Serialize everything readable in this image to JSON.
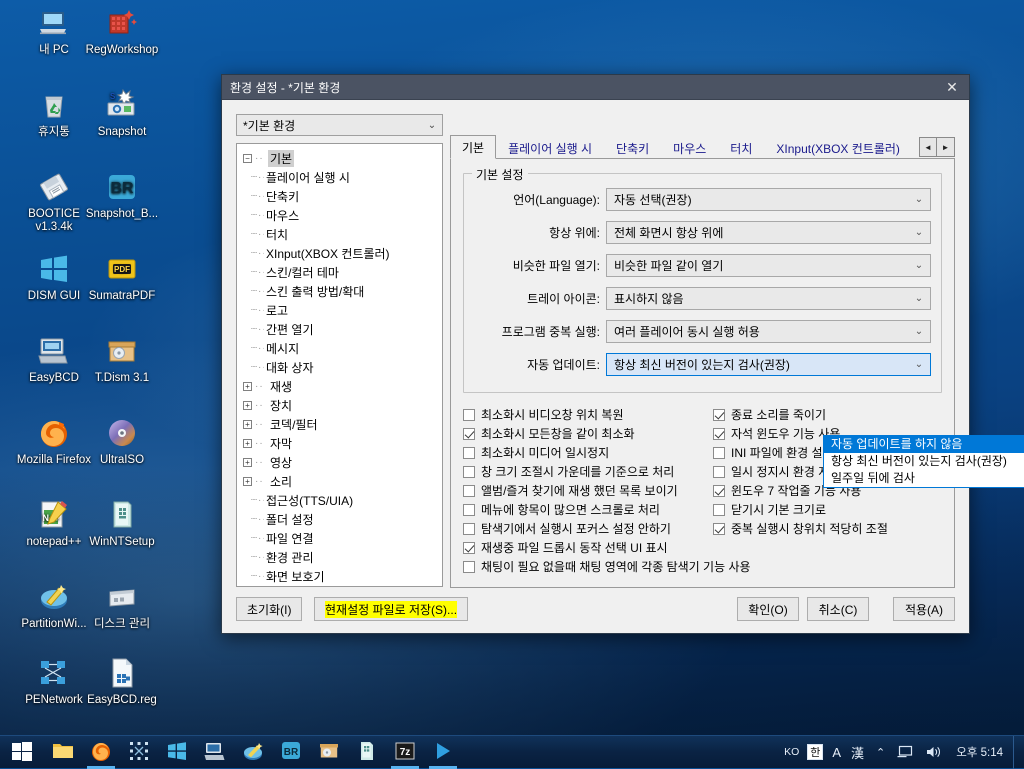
{
  "desktop": {
    "icons": [
      {
        "label": "내 PC",
        "icon": "computer-icon"
      },
      {
        "label": "RegWorkshop",
        "icon": "regworkshop-icon"
      },
      {
        "label": "휴지통",
        "icon": "recycle-bin-icon"
      },
      {
        "label": "Snapshot",
        "icon": "snapshot-icon"
      },
      {
        "label": "BOOTICE v1.3.4k",
        "icon": "bootice-icon"
      },
      {
        "label": "Snapshot_B...",
        "icon": "bootrepair-icon"
      },
      {
        "label": "DISM GUI",
        "icon": "dism-gui-icon"
      },
      {
        "label": "SumatraPDF",
        "icon": "sumatrapdf-icon"
      },
      {
        "label": "EasyBCD",
        "icon": "easybcd-icon"
      },
      {
        "label": "T.Dism 3.1",
        "icon": "tdism-icon"
      },
      {
        "label": "Mozilla Firefox",
        "icon": "firefox-icon"
      },
      {
        "label": "UltraISO",
        "icon": "ultraiso-icon"
      },
      {
        "label": "notepad++",
        "icon": "notepadpp-icon"
      },
      {
        "label": "WinNTSetup",
        "icon": "winntsetup-icon"
      },
      {
        "label": "PartitionWi...",
        "icon": "partitionwizard-icon"
      },
      {
        "label": "디스크 관리",
        "icon": "disk-management-icon"
      },
      {
        "label": "PENetwork",
        "icon": "penetwork-icon"
      },
      {
        "label": "EasyBCD.reg",
        "icon": "reg-file-icon"
      }
    ]
  },
  "window": {
    "title": "환경 설정 - *기본 환경",
    "close_label": "✕",
    "profile_combo": {
      "value": "*기본 환경",
      "arrow": "⌄"
    },
    "tree": [
      {
        "label": "기본",
        "level": 0,
        "expander": "−",
        "selected": true
      },
      {
        "label": "플레이어 실행 시",
        "level": 1,
        "expander": "",
        "selected": false
      },
      {
        "label": "단축키",
        "level": 1,
        "expander": "",
        "selected": false
      },
      {
        "label": "마우스",
        "level": 1,
        "expander": "",
        "selected": false
      },
      {
        "label": "터치",
        "level": 1,
        "expander": "",
        "selected": false
      },
      {
        "label": "XInput(XBOX 컨트롤러)",
        "level": 1,
        "expander": "",
        "selected": false
      },
      {
        "label": "스킨/컬러 테마",
        "level": 1,
        "expander": "",
        "selected": false
      },
      {
        "label": "스킨 출력 방법/확대",
        "level": 1,
        "expander": "",
        "selected": false
      },
      {
        "label": "로고",
        "level": 1,
        "expander": "",
        "selected": false
      },
      {
        "label": "간편 열기",
        "level": 1,
        "expander": "",
        "selected": false
      },
      {
        "label": "메시지",
        "level": 1,
        "expander": "",
        "selected": false
      },
      {
        "label": "대화 상자",
        "level": 1,
        "expander": "",
        "selected": false
      },
      {
        "label": "재생",
        "level": 0,
        "expander": "+",
        "selected": false
      },
      {
        "label": "장치",
        "level": 0,
        "expander": "+",
        "selected": false
      },
      {
        "label": "코덱/필터",
        "level": 0,
        "expander": "+",
        "selected": false
      },
      {
        "label": "자막",
        "level": 0,
        "expander": "+",
        "selected": false
      },
      {
        "label": "영상",
        "level": 0,
        "expander": "+",
        "selected": false
      },
      {
        "label": "소리",
        "level": 0,
        "expander": "+",
        "selected": false
      },
      {
        "label": "접근성(TTS/UIA)",
        "level": 1,
        "expander": "",
        "selected": false
      },
      {
        "label": "폴더 설정",
        "level": 1,
        "expander": "",
        "selected": false
      },
      {
        "label": "파일 연결",
        "level": 1,
        "expander": "",
        "selected": false
      },
      {
        "label": "환경 관리",
        "level": 1,
        "expander": "",
        "selected": false
      },
      {
        "label": "화면 보호기",
        "level": 1,
        "expander": "",
        "selected": false
      }
    ],
    "tabs": [
      {
        "label": "기본",
        "active": true
      },
      {
        "label": "플레이어 실행 시",
        "active": false
      },
      {
        "label": "단축키",
        "active": false
      },
      {
        "label": "마우스",
        "active": false
      },
      {
        "label": "터치",
        "active": false
      },
      {
        "label": "XInput(XBOX 컨트롤러)",
        "active": false
      }
    ],
    "tab_nav": {
      "prev": "◄",
      "next": "►"
    },
    "group": {
      "legend": "기본 설정",
      "fields": [
        {
          "label": "언어(Language):",
          "value": "자동 선택(권장)",
          "arrow": "⌄",
          "open": false
        },
        {
          "label": "항상 위에:",
          "value": "전체 화면시 항상 위에",
          "arrow": "⌄",
          "open": false
        },
        {
          "label": "비슷한 파일 열기:",
          "value": "비슷한 파일 같이 열기",
          "arrow": "⌄",
          "open": false
        },
        {
          "label": "트레이 아이콘:",
          "value": "표시하지 않음",
          "arrow": "⌄",
          "open": false
        },
        {
          "label": "프로그램 중복 실행:",
          "value": "여러 플레이어 동시 실행 허용",
          "arrow": "⌄",
          "open": false
        },
        {
          "label": "자동 업데이트:",
          "value": "항상 최신 버전이 있는지 검사(권장)",
          "arrow": "⌄",
          "open": true
        }
      ]
    },
    "dropdown": {
      "open": true,
      "options": [
        {
          "label": "자동 업데이트를 하지 않음",
          "selected": true
        },
        {
          "label": "항상 최신 버전이 있는지 검사(권장)",
          "selected": false
        },
        {
          "label": "일주일 뒤에 검사",
          "selected": false
        }
      ]
    },
    "checkboxes_left": [
      {
        "label": "최소화시 비디오창 위치 복원",
        "checked": false
      },
      {
        "label": "최소화시 모든창을 같이 최소화",
        "checked": true
      },
      {
        "label": "최소화시 미디어 일시정지",
        "checked": false
      },
      {
        "label": "창 크기 조절시 가운데를 기준으로 처리",
        "checked": false
      },
      {
        "label": "앨범/즐겨 찾기에 재생 했던 목록 보이기",
        "checked": false
      },
      {
        "label": "메뉴에 항목이 많으면 스크롤로 처리",
        "checked": false
      },
      {
        "label": "탐색기에서 실행시 포커스 설정 안하기",
        "checked": false
      },
      {
        "label": "재생중 파일 드롭시 동작 선택 UI 표시",
        "checked": true
      }
    ],
    "checkboxes_right": [
      {
        "label": "종료 소리를 죽이기",
        "checked": true
      },
      {
        "label": "자석 윈도우 기능 사용",
        "checked": true
      },
      {
        "label": "INI 파일에 환경 설정 저장",
        "checked": false
      },
      {
        "label": "일시 정지시 환경 저장",
        "checked": false
      },
      {
        "label": "윈도우 7 작업줄 기능 사용",
        "checked": true
      },
      {
        "label": "닫기시 기본 크기로",
        "checked": false
      },
      {
        "label": "중복 실행시 창위치 적당히 조절",
        "checked": true
      }
    ],
    "checkbox_wide": {
      "label": "채팅이 필요 없을때 채팅 영역에 각종 탐색기 기능 사용",
      "checked": false
    },
    "buttons": {
      "reset": "초기화(I)",
      "save_prefix": "현재",
      "save_rest": " 설정 파일로 저장(S)...",
      "ok": "확인(O)",
      "cancel": "취소(C)",
      "apply": "적용(A)"
    }
  },
  "taskbar": {
    "start_label": "start-button",
    "items": [
      {
        "name": "file-explorer-icon",
        "running": false
      },
      {
        "name": "firefox-icon",
        "running": true
      },
      {
        "name": "selection-tool-icon",
        "running": false
      },
      {
        "name": "windows-tool-icon",
        "running": false
      },
      {
        "name": "easybcd-icon",
        "running": false
      },
      {
        "name": "partition-wizard-icon",
        "running": false
      },
      {
        "name": "bootrepair-icon",
        "running": false
      },
      {
        "name": "tdism-icon",
        "running": false
      },
      {
        "name": "winntsetup-icon",
        "running": false
      },
      {
        "name": "7zip-icon",
        "running": true
      },
      {
        "name": "media-player-icon",
        "running": true
      }
    ],
    "tray": {
      "lang": "KO",
      "ime_han": "한",
      "ime_alpha": "A",
      "ime_hanja": "漢",
      "chevron": "⌃",
      "monitor": "monitor-icon",
      "volume": "volume-icon",
      "clock": "오후 5:14"
    }
  }
}
